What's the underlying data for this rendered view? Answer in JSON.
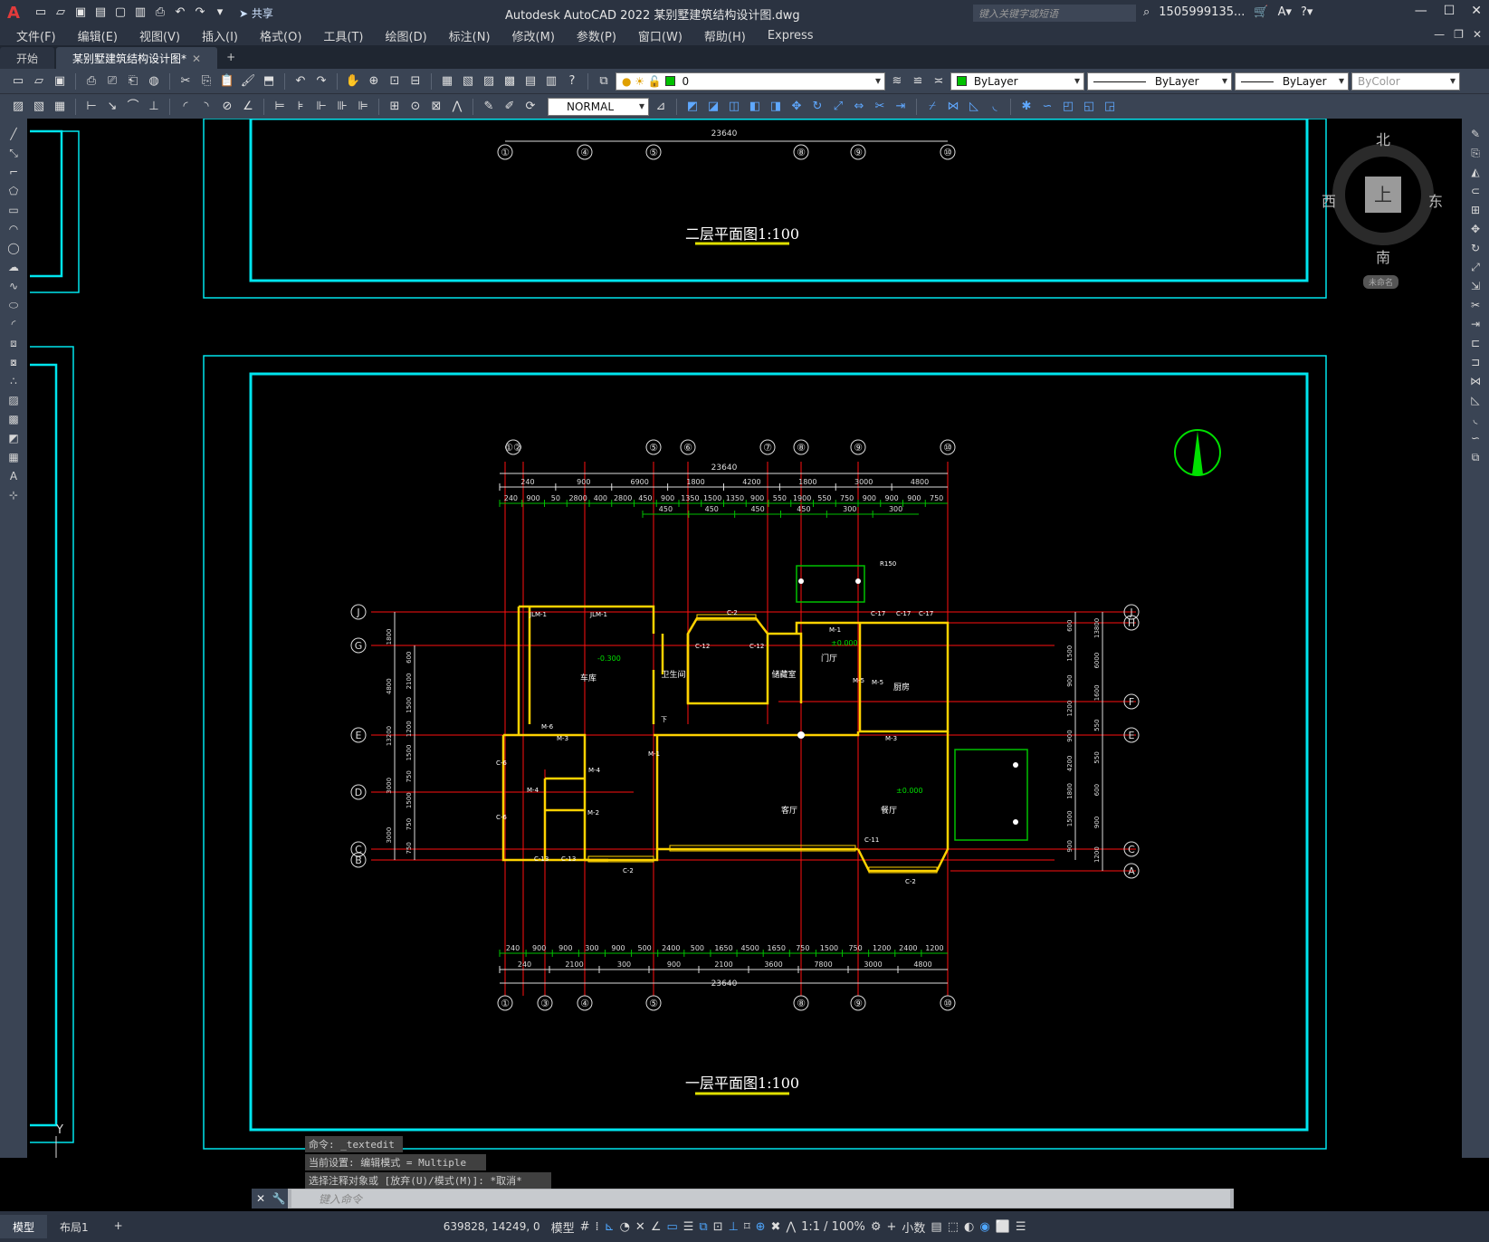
{
  "app": {
    "title": "Autodesk AutoCAD 2022    某别墅建筑结构设计图.dwg",
    "logo": "A",
    "share_label": "共享",
    "search_placeholder": "键入关键字或短语",
    "user": "1505999135..."
  },
  "menu": [
    "文件(F)",
    "编辑(E)",
    "视图(V)",
    "插入(I)",
    "格式(O)",
    "工具(T)",
    "绘图(D)",
    "标注(N)",
    "修改(M)",
    "参数(P)",
    "窗口(W)",
    "帮助(H)",
    "Express"
  ],
  "tabs": [
    {
      "label": "开始"
    },
    {
      "label": "某别墅建筑结构设计图*"
    }
  ],
  "toolbar": {
    "layer_value": "0",
    "color_value": "ByLayer",
    "linetype_value": "ByLayer",
    "lineweight_value": "ByLayer",
    "plotstyle_value": "ByColor",
    "dimstyle_value": "NORMAL",
    "accent_green": "#00c000"
  },
  "viewcube": {
    "north": "北",
    "south": "南",
    "east": "东",
    "west": "西",
    "face": "上",
    "label": "未命名"
  },
  "drawing": {
    "title_upper": "二层平面图1:100",
    "title_lower": "一层平面图1:100",
    "total_dim": "23640",
    "top_axes_upper": [
      "①",
      "④",
      "⑤",
      "⑧",
      "⑨",
      "⑩"
    ],
    "top_axes": [
      "①②",
      "⑤",
      "⑥",
      "⑦",
      "⑧",
      "⑨",
      "⑩"
    ],
    "bottom_axes": [
      "①",
      "③",
      "④",
      "⑤",
      "⑧",
      "⑨",
      "⑩"
    ],
    "left_axes": [
      "J",
      "G",
      "E",
      "D",
      "C",
      "B"
    ],
    "right_axes": [
      "J",
      "H",
      "F",
      "E",
      "C",
      "A"
    ],
    "dim_row1": [
      "240",
      "900",
      "6900",
      "1800",
      "4200",
      "1800",
      "3000",
      "4800"
    ],
    "dim_row2": [
      "240",
      "900",
      "50",
      "2800",
      "400",
      "2800",
      "450",
      "900",
      "1350",
      "1500",
      "1350",
      "900",
      "550",
      "1900",
      "550",
      "750",
      "900",
      "900",
      "900",
      "750"
    ],
    "dim_row3": [
      "450",
      "450",
      "450",
      "450",
      "300",
      "300"
    ],
    "bottom_dim_row1": [
      "240",
      "900",
      "900",
      "300",
      "900",
      "500",
      "2400",
      "500",
      "1650",
      "4500",
      "1650",
      "750",
      "1500",
      "750",
      "1200",
      "2400",
      "1200"
    ],
    "bottom_dim_row2": [
      "240",
      "2100",
      "300",
      "900",
      "2100",
      "3600",
      "7800",
      "3000",
      "4800"
    ],
    "left_dims": [
      "1800",
      "4800",
      "13200",
      "3000",
      "3000",
      "600",
      "2100",
      "1500",
      "1200",
      "1500",
      "750",
      "1500",
      "750",
      "750"
    ],
    "right_dims": [
      "600",
      "1500",
      "900",
      "1200",
      "900",
      "4200",
      "1800",
      "1500",
      "900",
      "13800",
      "6000",
      "1600",
      "550",
      "550",
      "600",
      "900",
      "1200"
    ],
    "room_labels": [
      "车库",
      "卫生间",
      "储藏室",
      "门厅",
      "厨房",
      "客厅",
      "餐厅"
    ],
    "levels": [
      "-0.300",
      "±0.000",
      "±0.000"
    ],
    "window_labels": [
      "JLM-1",
      "JLM-1",
      "C-2",
      "C-12",
      "C-12",
      "M-1",
      "C-17",
      "C-17",
      "C-17",
      "M-3",
      "M-5",
      "M-3",
      "M-6",
      "M-4",
      "C-6",
      "C-6",
      "M-2",
      "C-13",
      "C-13",
      "C-2",
      "C-2",
      "C-11",
      "M-1",
      "M-5",
      "R150",
      "下",
      "M-4"
    ]
  },
  "command": {
    "history": [
      "命令: _textedit",
      "当前设置: 编辑模式 = Multiple",
      "选择注释对象或 [放弃(U)/模式(M)]: *取消*"
    ],
    "placeholder": "键入命令"
  },
  "status": {
    "tabs": [
      "模型",
      "布局1"
    ],
    "coords": "639828, 14249, 0",
    "model_label": "模型",
    "scale": "1:1 / 100%",
    "units": "小数"
  }
}
